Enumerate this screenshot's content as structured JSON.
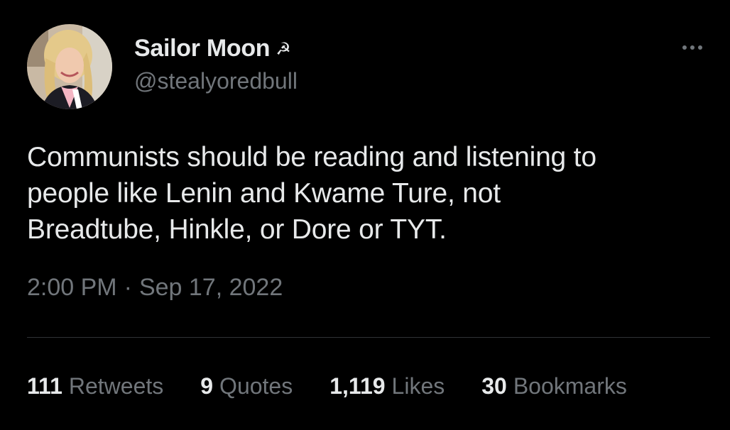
{
  "author": {
    "display_name": "Sailor Moon",
    "name_emoji": "☭",
    "handle": "@stealyoredbull",
    "avatar_icon": "profile-photo"
  },
  "tweet": {
    "text": "Communists should be reading and listening to\npeople like Lenin and Kwame Ture, not\nBreadtube, Hinkle, or Dore or TYT.",
    "time": "2:00 PM",
    "separator": "·",
    "date": "Sep 17, 2022"
  },
  "stats": [
    {
      "count": "111",
      "label": "Retweets"
    },
    {
      "count": "9",
      "label": "Quotes"
    },
    {
      "count": "1,119",
      "label": "Likes"
    },
    {
      "count": "30",
      "label": "Bookmarks"
    }
  ],
  "colors": {
    "background": "#000000",
    "primary_text": "#e7e9ea",
    "secondary_text": "#71767b",
    "divider": "#2f3336"
  },
  "more_icon": "more-horizontal-icon"
}
